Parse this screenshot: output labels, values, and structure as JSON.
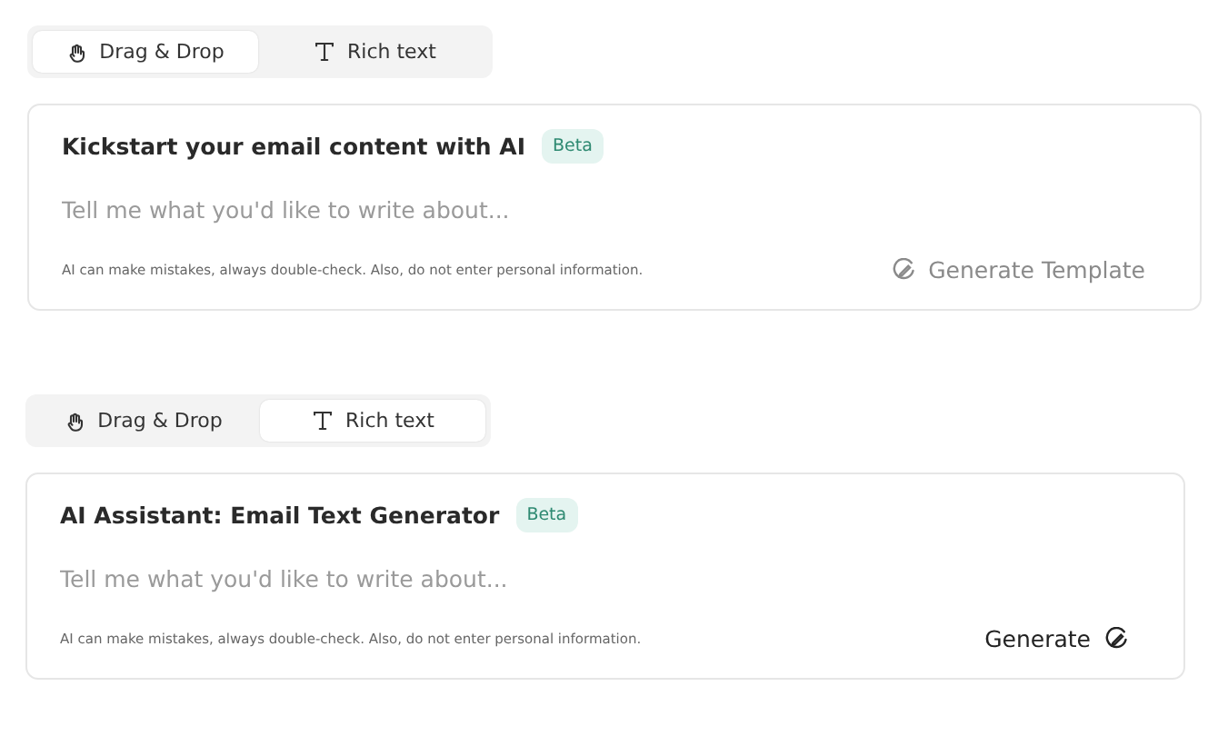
{
  "panels": [
    {
      "tabs": [
        {
          "label": "Drag & Drop",
          "kind": "dragdrop",
          "selected": true
        },
        {
          "label": "Rich text",
          "kind": "text",
          "selected": false
        }
      ],
      "card": {
        "title": "Kickstart your email content with AI",
        "badge": "Beta",
        "placeholder": "Tell me what you'd like to write about...",
        "disclaimer": "AI can make mistakes, always double-check. Also, do not enter personal information.",
        "button": {
          "label": "Generate Template",
          "disabled": true,
          "kind": "prefixed"
        }
      }
    },
    {
      "tabs": [
        {
          "label": "Drag & Drop",
          "kind": "dragdrop",
          "selected": false
        },
        {
          "label": "Rich text",
          "kind": "text",
          "selected": true
        }
      ],
      "card": {
        "title": "AI Assistant: Email Text Generator",
        "badge": "Beta",
        "placeholder": "Tell me what you'd like to write about...",
        "disclaimer": "AI can make mistakes, always double-check. Also, do not enter personal information.",
        "button": {
          "label": "Generate",
          "disabled": false,
          "kind": "suffixed"
        }
      }
    }
  ]
}
